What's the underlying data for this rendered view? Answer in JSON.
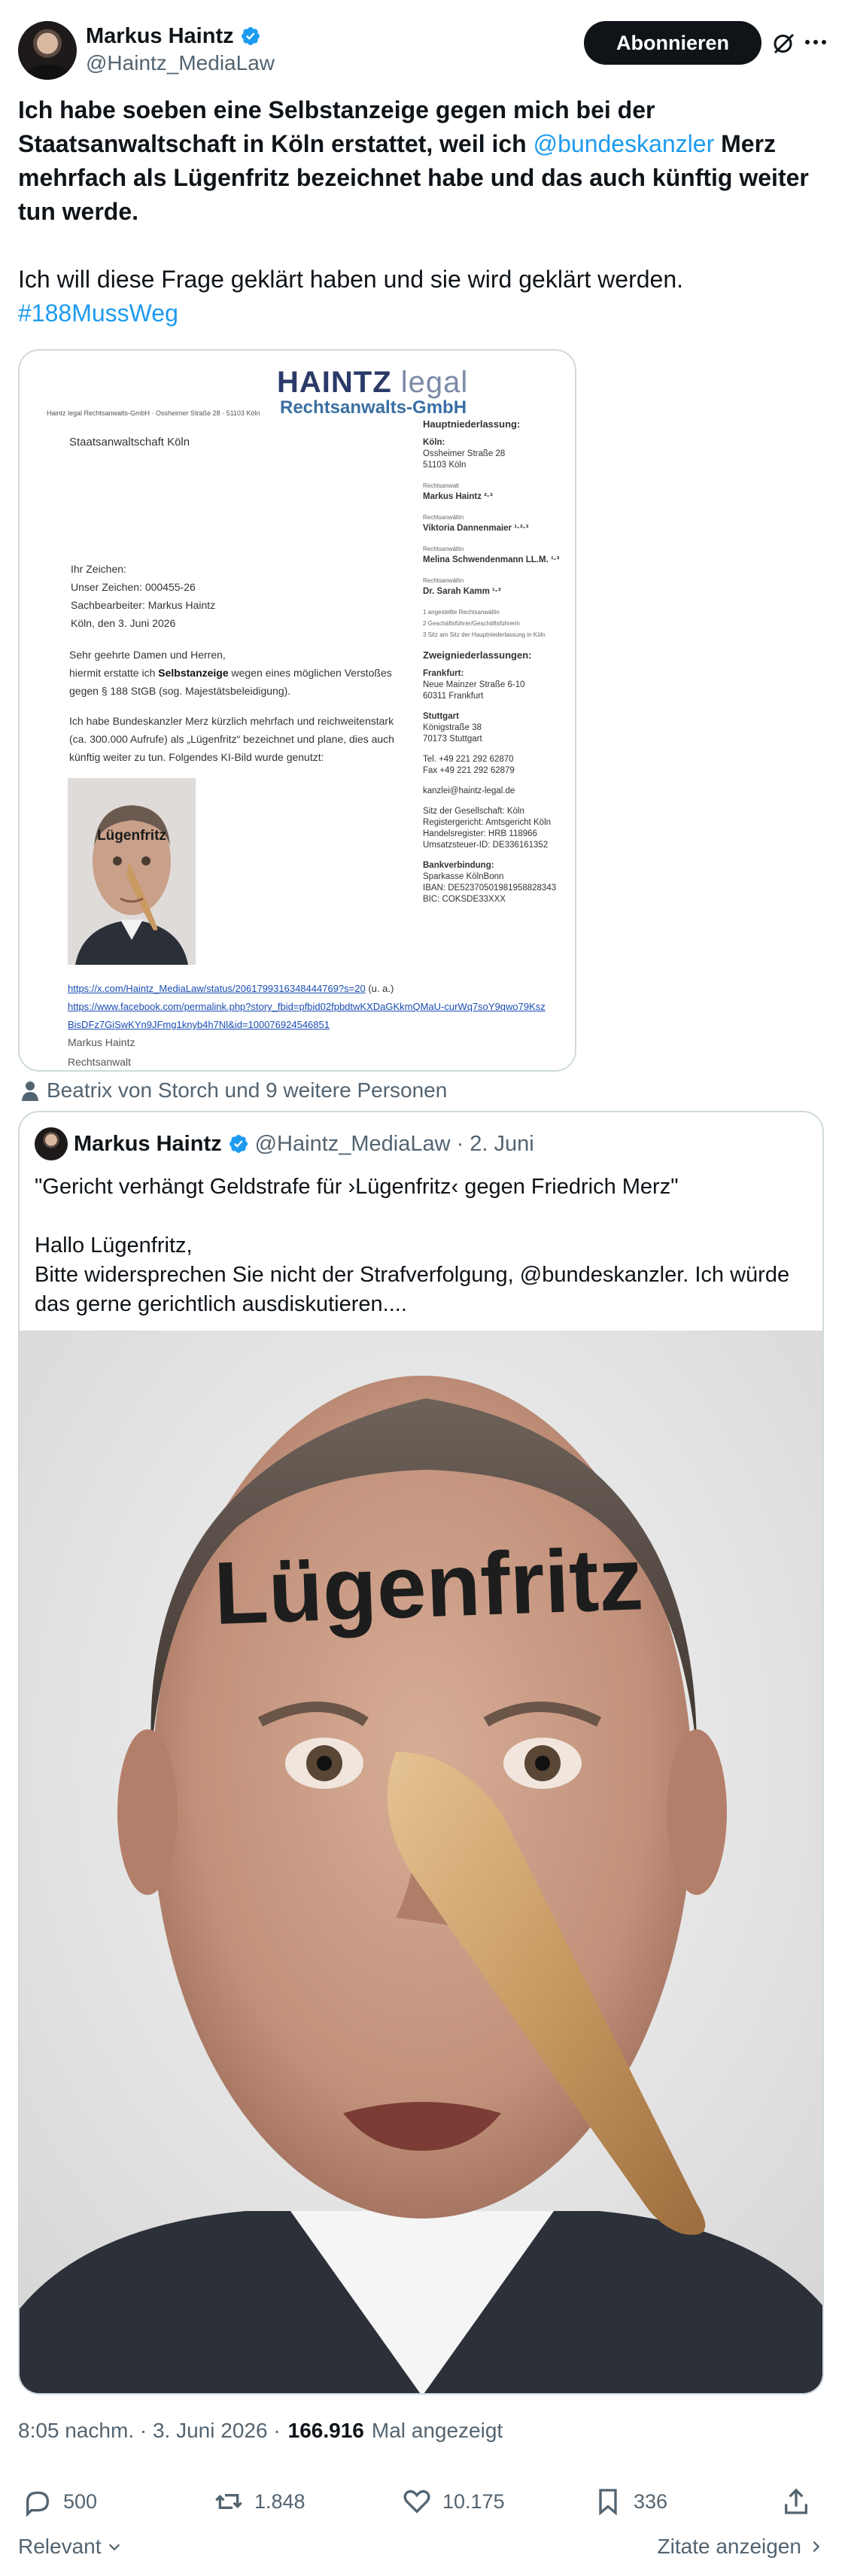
{
  "author": {
    "display_name": "Markus Haintz",
    "handle": "@Haintz_MediaLaw",
    "verified": true
  },
  "header": {
    "follow_label": "Abonnieren",
    "icons": [
      "grok-icon",
      "more-icon"
    ]
  },
  "tweet": {
    "text_part1": "Ich habe soeben eine Selbstanzeige gegen mich bei der Staatsanwaltschaft in Köln erstattet, weil ich ",
    "mention": "@bundeskanzler",
    "text_part2": " Merz mehrfach als Lügenfritz bezeichnet habe und das auch künftig weiter tun werde.",
    "paragraph2": "Ich will diese Frage geklärt haben und sie wird geklärt werden.",
    "hashtag": "#188MussWeg"
  },
  "document": {
    "logo_word1": "HAINTZ",
    "logo_word2": "legal",
    "logo_subtitle": "Rechtsanwalts-GmbH",
    "sender_line": "Haintz legal Rechtsanwalts-GmbH · Ossheimer Straße 28 · 51103 Köln",
    "recipient": "Staatsanwaltschaft Köln",
    "meta": {
      "ihr_zeichen": "Ihr Zeichen:",
      "unser_zeichen": "Unser Zeichen: 000455-26",
      "sachbearbeiter": "Sachbearbeiter: Markus Haintz",
      "ort_datum": "Köln, den 3. Juni 2026"
    },
    "body": {
      "greeting": "Sehr geehrte Damen und Herren,",
      "p1_before": "hiermit erstatte ich ",
      "p1_bold": "Selbstanzeige",
      "p1_after": " wegen eines möglichen Verstoßes gegen § 188 StGB (sog. Majestätsbeleidigung).",
      "p2": "Ich habe Bundeskanzler Merz kürzlich mehrfach und reichweitenstark (ca. 300.000 Aufrufe) als „Lügenfritz“ bezeichnet und plane, dies auch künftig weiter zu tun. Folgendes KI-Bild wurde genutzt:"
    },
    "photo_caption": "Lügenfritz",
    "link1": "https://x.com/Haintz_MediaLaw/status/2061799316348444769?s=20",
    "link1_suffix": "(u. a.)",
    "link2": "https://www.facebook.com/permalink.php?story_fbid=pfbid02fpbdtwKXDaGKkmQMaU-curWq7soY9qwo79KszBisDFz7GiSwKYn9JFmg1knyb4h7Nl&id=100076924546851",
    "signature_name": "Markus Haintz",
    "signature_role": "Rechtsanwalt",
    "right": {
      "hauptniederlassung": "Hauptniederlassung:",
      "koeln_label": "Köln:",
      "koeln_street": "Ossheimer Straße 28",
      "koeln_city": "51103 Köln",
      "lawyer1_role": "Rechtsanwalt",
      "lawyer1_name": "Markus Haintz ²·³",
      "lawyer2_role": "Rechtsanwältin",
      "lawyer2_name": "Viktoria Dannenmaier ¹·²·³",
      "lawyer3_role": "Rechtsanwältin",
      "lawyer3_name": "Melina Schwendenmann LL.M. ¹·³",
      "lawyer4_role": "Rechtsanwältin",
      "lawyer4_name": "Dr. Sarah Kamm ¹·³",
      "footnote1": "1 angestellte Rechtsanwältin",
      "footnote2": "2 Geschäftsführer/Geschäftsführerin",
      "footnote3": "3 Sitz am Sitz der Hauptniederlassung in Köln",
      "zweig": "Zweigniederlassungen:",
      "frankfurt_label": "Frankfurt:",
      "frankfurt_street": "Neue Mainzer Straße 6-10",
      "frankfurt_city": "60311 Frankfurt",
      "stuttgart_label": "Stuttgart",
      "stuttgart_street": "Königstraße 38",
      "stuttgart_city": "70173 Stuttgart",
      "tel": "Tel.     +49 221 292 62870",
      "fax": "Fax     +49 221 292 62879",
      "email": "kanzlei@haintz-legal.de",
      "sitz": "Sitz der Gesellschaft: Köln",
      "register": "Registergericht: Amtsgericht Köln",
      "hrb": "Handelsregister: HRB 118966",
      "ust": "Umsatzsteuer-ID: DE336161352",
      "bank_label": "Bankverbindung:",
      "bank": "Sparkasse KölnBonn",
      "iban": "IBAN:   DE52370501981958828343",
      "bic": "BIC:     COKSDE33XXX"
    }
  },
  "social_context": "Beatrix von Storch und 9 weitere Personen",
  "quote": {
    "display_name": "Markus Haintz",
    "handle": "@Haintz_MediaLaw",
    "separator": "·",
    "date": "2. Juni",
    "line1": "\"Gericht verhängt Geldstrafe für ›Lügenfritz‹ gegen Friedrich Merz\"",
    "line2": "Hallo Lügenfritz,",
    "line3": "Bitte widersprechen Sie nicht der Strafverfolgung, @bundeskanzler. Ich würde das gerne gerichtlich ausdiskutieren....",
    "image_caption": "Lügenfritz"
  },
  "meta": {
    "time_date": "8:05 nachm. · 3. Juni 2026 ·",
    "views": "166.916",
    "views_label": "Mal angezeigt"
  },
  "actions": {
    "replies": "500",
    "reposts": "1.848",
    "likes": "10.175",
    "bookmarks": "336"
  },
  "bottom": {
    "sort_label": "Relevant",
    "quotes_label": "Zitate anzeigen"
  }
}
